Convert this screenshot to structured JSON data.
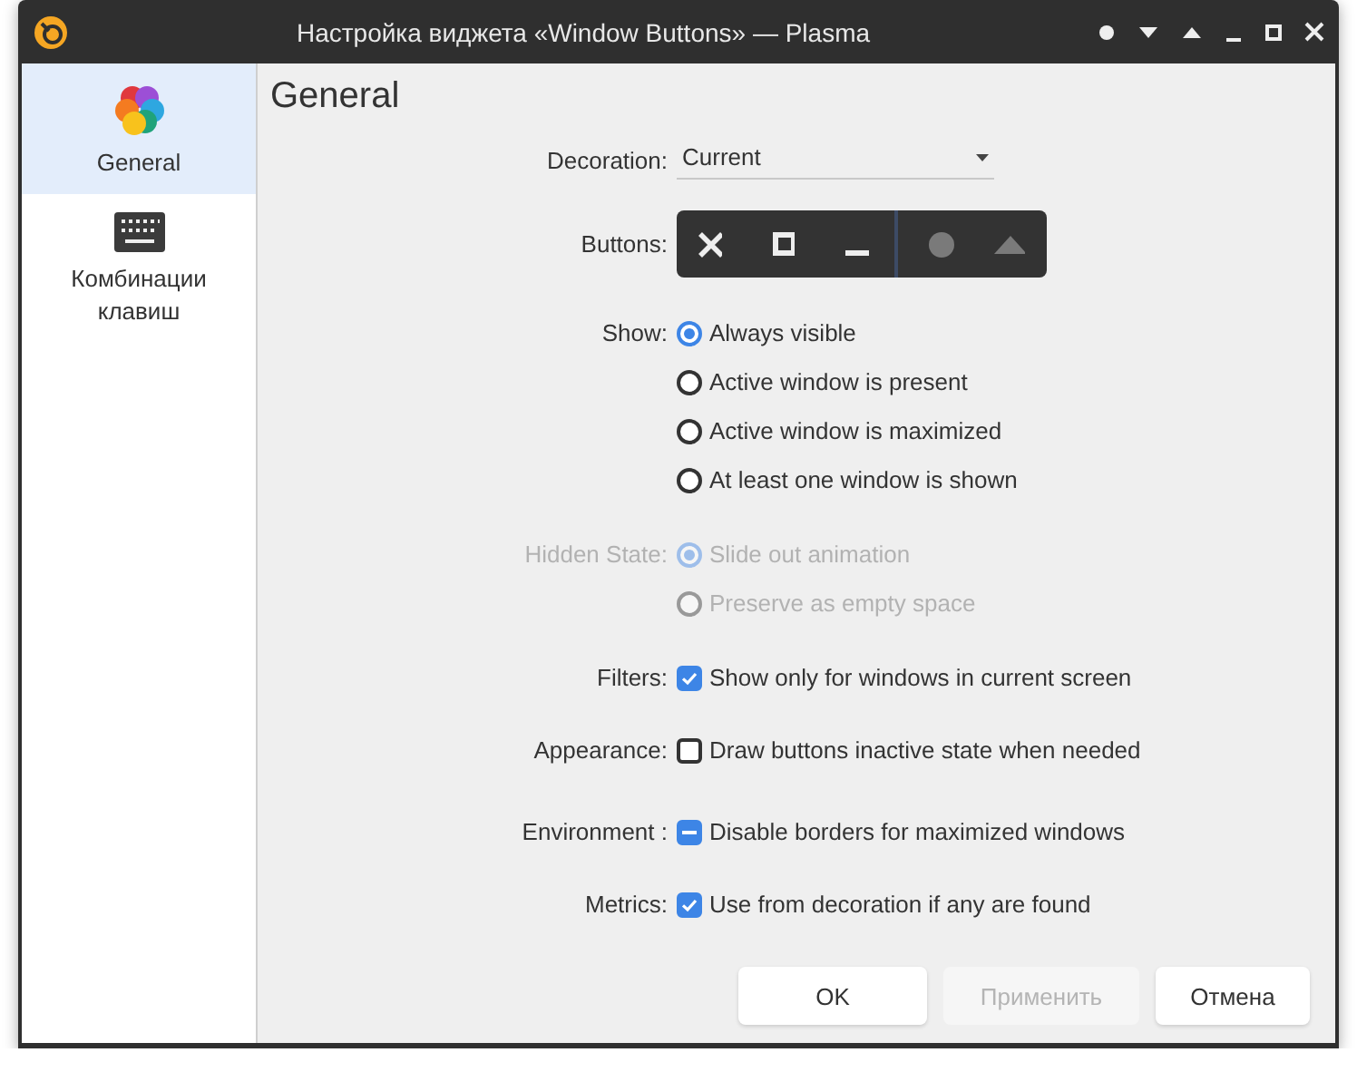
{
  "window": {
    "title": "Настройка виджета «Window Buttons» — Plasma"
  },
  "sidebar": {
    "items": [
      {
        "label": "General",
        "selected": true
      },
      {
        "label": "Комбинации клавиш",
        "selected": false
      }
    ]
  },
  "page": {
    "heading": "General"
  },
  "form": {
    "rows": [
      {
        "kind": "combo",
        "label": "Decoration:",
        "value": "Current",
        "disabled": false
      },
      {
        "kind": "preview",
        "label": "Buttons:",
        "disabled": false
      },
      {
        "kind": "radios",
        "label": "Show:",
        "disabled": false,
        "options": [
          {
            "label": "Always visible",
            "selected": true
          },
          {
            "label": "Active window is present",
            "selected": false
          },
          {
            "label": "Active window is maximized",
            "selected": false
          },
          {
            "label": "At least one window is shown",
            "selected": false
          }
        ]
      },
      {
        "kind": "radios",
        "label": "Hidden State:",
        "disabled": true,
        "options": [
          {
            "label": "Slide out animation",
            "selected": true
          },
          {
            "label": "Preserve as empty space",
            "selected": false
          }
        ]
      },
      {
        "kind": "check",
        "label": "Filters:",
        "text": "Show only for windows in current screen",
        "checked": true,
        "partial": false,
        "disabled": false
      },
      {
        "kind": "check",
        "label": "Appearance:",
        "text": "Draw buttons inactive state when needed",
        "checked": false,
        "partial": false,
        "disabled": false
      },
      {
        "kind": "check",
        "label": "Environment :",
        "text": "Disable borders for maximized windows",
        "checked": true,
        "partial": true,
        "disabled": false
      },
      {
        "kind": "check",
        "label": "Metrics:",
        "text": "Use from decoration if any are found",
        "checked": true,
        "partial": false,
        "disabled": false
      }
    ]
  },
  "footer": {
    "buttons": [
      {
        "label": "OK",
        "disabled": false
      },
      {
        "label": "Применить",
        "disabled": true
      },
      {
        "label": "Отмена",
        "disabled": false
      }
    ]
  }
}
